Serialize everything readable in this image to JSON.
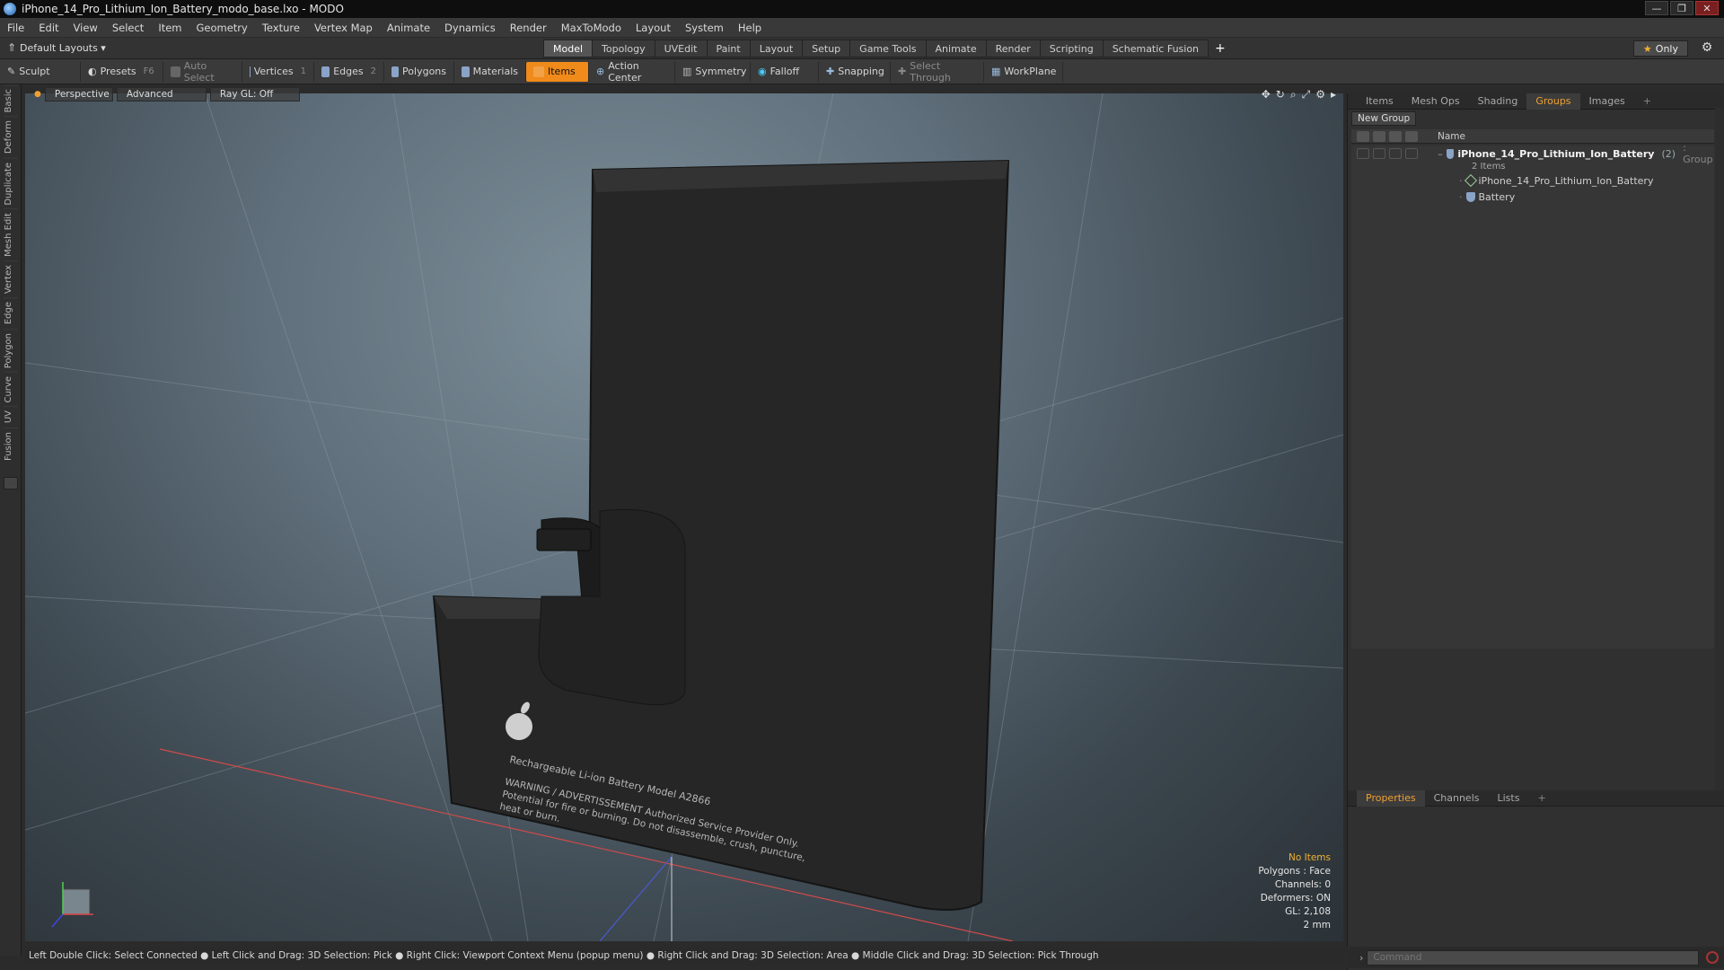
{
  "window": {
    "title": "iPhone_14_Pro_Lithium_Ion_Battery_modo_base.lxo - MODO"
  },
  "menu": [
    "File",
    "Edit",
    "View",
    "Select",
    "Item",
    "Geometry",
    "Texture",
    "Vertex Map",
    "Animate",
    "Dynamics",
    "Render",
    "MaxToModo",
    "Layout",
    "System",
    "Help"
  ],
  "layoutbar": {
    "layout_select": "Default Layouts ▾",
    "tabs": [
      "Model",
      "Topology",
      "UVEdit",
      "Paint",
      "Layout",
      "Setup",
      "Game Tools",
      "Animate",
      "Render",
      "Scripting",
      "Schematic Fusion"
    ],
    "active_tab": "Model",
    "only_label": "Only"
  },
  "toolbar": {
    "sculpt": "Sculpt",
    "presets": "Presets",
    "presets_key": "F6",
    "auto_select": "Auto Select",
    "vertices": "Vertices",
    "vertices_key": "1",
    "edges": "Edges",
    "edges_key": "2",
    "polygons": "Polygons",
    "materials": "Materials",
    "items": "Items",
    "action_center": "Action Center",
    "symmetry": "Symmetry",
    "falloff": "Falloff",
    "snapping": "Snapping",
    "select_through": "Select Through",
    "workplane": "WorkPlane"
  },
  "leftstrip": [
    "Basic",
    "Deform",
    "Duplicate",
    "Mesh Edit",
    "Vertex",
    "Edge",
    "Polygon",
    "Curve",
    "UV",
    "Fusion"
  ],
  "viewport": {
    "view_mode": "Perspective",
    "shading": "Advanced",
    "raygl": "Ray GL: Off",
    "battery_label_model": "Rechargeable Li-ion Battery Model A2866",
    "battery_label_warning": "WARNING / ADVERTISSEMENT Authorized Service Provider Only.",
    "battery_label_warning2": "Potential for fire or burning. Do not disassemble, crush, puncture,",
    "battery_label_warning3": "heat or burn."
  },
  "hud": {
    "no_items": "No Items",
    "polygons": "Polygons : Face",
    "channels": "Channels: 0",
    "deformers": "Deformers: ON",
    "gl": "GL: 2,108",
    "unit": "2 mm"
  },
  "statusbar": "Left Double Click: Select Connected ● Left Click and Drag: 3D Selection: Pick ● Right Click: Viewport Context Menu (popup menu) ● Right Click and Drag: 3D Selection: Area ● Middle Click and Drag: 3D Selection: Pick Through",
  "panel_top": {
    "tabs": [
      "Items",
      "Mesh Ops",
      "Shading",
      "Groups",
      "Images",
      "+"
    ],
    "active_tab": "Groups",
    "new_group": "New Group",
    "col_name": "Name",
    "group": {
      "name": "iPhone_14_Pro_Lithium_Ion_Battery",
      "count": "(2)",
      "tag": ": Group",
      "sub": "2 Items",
      "children": [
        "iPhone_14_Pro_Lithium_Ion_Battery",
        "Battery"
      ]
    }
  },
  "panel_bottom": {
    "tabs": [
      "Properties",
      "Channels",
      "Lists",
      "+"
    ],
    "active_tab": "Properties"
  },
  "command": {
    "placeholder": "Command"
  },
  "colors": {
    "accent": "#f08a1a",
    "battery": "#262626"
  }
}
